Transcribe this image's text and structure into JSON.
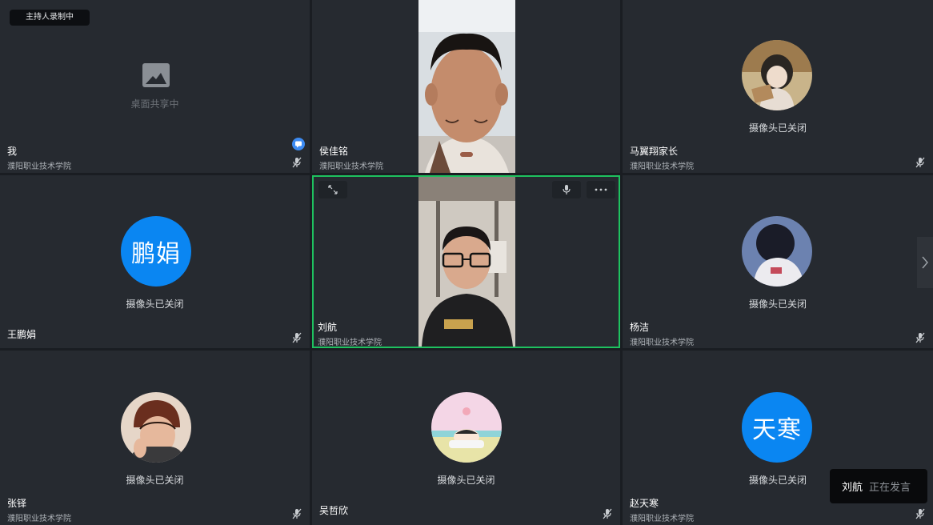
{
  "recording_badge": "主持人录制中",
  "screen_share_text": "桌面共享中",
  "camera_off_text": "摄像头已关闭",
  "speaking_indicator": {
    "name": "刘航",
    "status": "正在发言"
  },
  "participants": [
    {
      "name": "我",
      "org": "濮阳职业技术学院"
    },
    {
      "name": "侯佳铭",
      "org": "濮阳职业技术学院"
    },
    {
      "name": "马翼翔家长",
      "org": "濮阳职业技术学院"
    },
    {
      "name": "王鹏娟",
      "org": "",
      "avatar_text": "鹏娟"
    },
    {
      "name": "刘航",
      "org": "濮阳职业技术学院"
    },
    {
      "name": "杨洁",
      "org": "濮阳职业技术学院"
    },
    {
      "name": "张铎",
      "org": "濮阳职业技术学院"
    },
    {
      "name": "吴哲欣",
      "org": ""
    },
    {
      "name": "赵天寒",
      "org": "濮阳职业技术学院",
      "avatar_text": "天寒"
    }
  ],
  "colors": {
    "tile_bg": "#262a30",
    "active_border": "#1ec15f",
    "avatar_blue": "#0a86f2"
  }
}
